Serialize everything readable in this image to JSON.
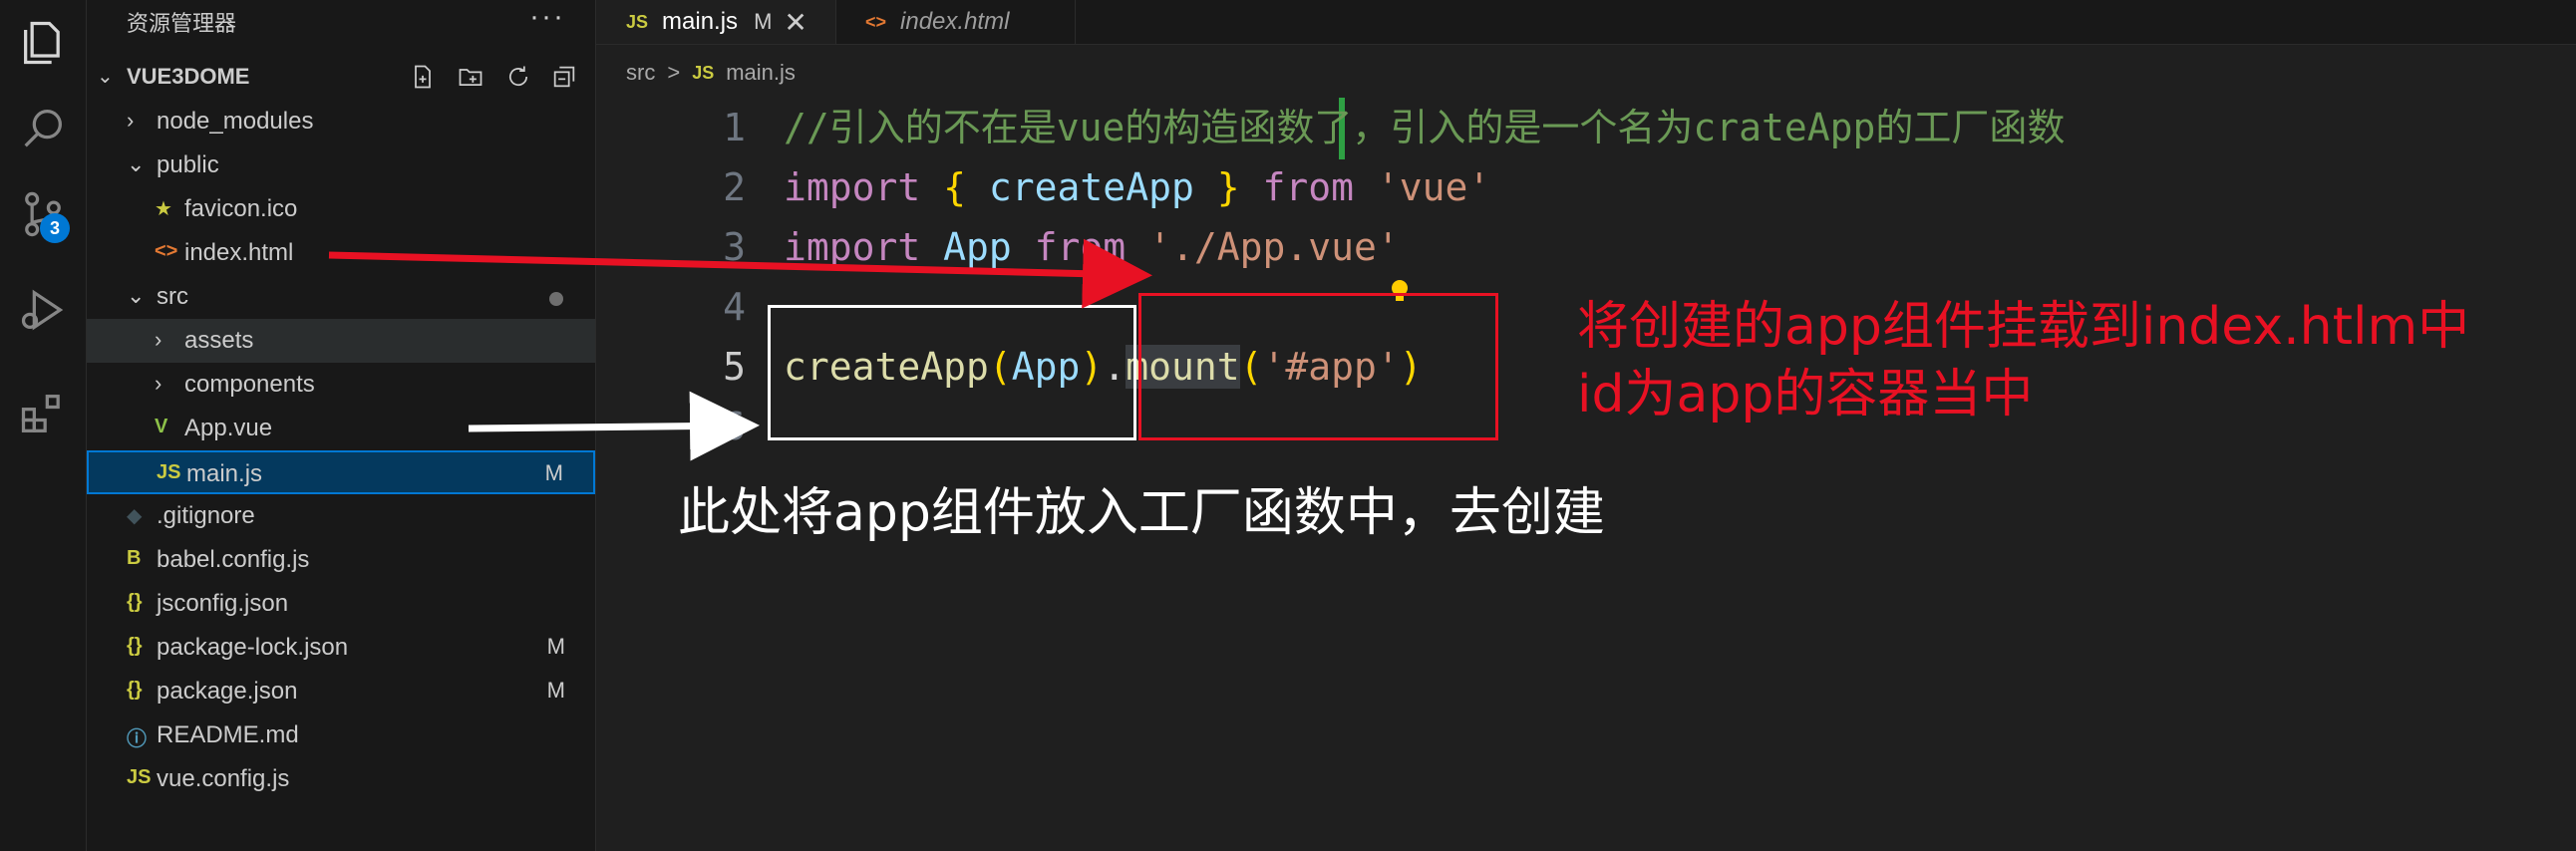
{
  "sidebar": {
    "title": "资源管理器",
    "more": "···",
    "project": "VUE3DOME",
    "project_actions": [
      "new-file-icon",
      "new-folder-icon",
      "refresh-icon",
      "collapse-icon"
    ],
    "items": [
      {
        "label": "node_modules",
        "type": "folder",
        "expanded": false,
        "depth": 1
      },
      {
        "label": "public",
        "type": "folder",
        "expanded": true,
        "depth": 1
      },
      {
        "label": "favicon.ico",
        "type": "file",
        "icon": "★",
        "icon_color": "#cbcb41",
        "depth": 2
      },
      {
        "label": "index.html",
        "type": "file",
        "icon": "<>",
        "icon_color": "#e37933",
        "depth": 2
      },
      {
        "label": "src",
        "type": "folder",
        "expanded": true,
        "depth": 1,
        "dot": true
      },
      {
        "label": "assets",
        "type": "folder",
        "expanded": false,
        "depth": 2,
        "hl": true
      },
      {
        "label": "components",
        "type": "folder",
        "expanded": false,
        "depth": 2
      },
      {
        "label": "App.vue",
        "type": "file",
        "icon": "V",
        "icon_color": "#8dc149",
        "depth": 2
      },
      {
        "label": "main.js",
        "type": "file",
        "icon": "JS",
        "icon_color": "#cbcb41",
        "depth": 2,
        "selected": true,
        "git": "M"
      },
      {
        "label": ".gitignore",
        "type": "file",
        "icon": "◆",
        "icon_color": "#41535b",
        "depth": 1
      },
      {
        "label": "babel.config.js",
        "type": "file",
        "icon": "B",
        "icon_color": "#cbcb41",
        "depth": 1
      },
      {
        "label": "jsconfig.json",
        "type": "file",
        "icon": "{}",
        "icon_color": "#cbcb41",
        "depth": 1
      },
      {
        "label": "package-lock.json",
        "type": "file",
        "icon": "{}",
        "icon_color": "#cbcb41",
        "depth": 1,
        "git": "M"
      },
      {
        "label": "package.json",
        "type": "file",
        "icon": "{}",
        "icon_color": "#cbcb41",
        "depth": 1,
        "git": "M"
      },
      {
        "label": "README.md",
        "type": "file",
        "icon": "ⓘ",
        "icon_color": "#519aba",
        "depth": 1
      },
      {
        "label": "vue.config.js",
        "type": "file",
        "icon": "JS",
        "icon_color": "#cbcb41",
        "depth": 1
      }
    ]
  },
  "activity": {
    "badge": "3"
  },
  "tabs": [
    {
      "label": "main.js",
      "icon": "JS",
      "icon_color": "#cbcb41",
      "modified": "M",
      "close": "✕",
      "active": true
    },
    {
      "label": "index.html",
      "icon": "<>",
      "icon_color": "#e37933",
      "active": false
    }
  ],
  "breadcrumb": {
    "folder": "src",
    "sep": ">",
    "file_icon": "JS",
    "file": "main.js"
  },
  "code": {
    "lines": [
      {
        "n": "1",
        "segments": [
          {
            "t": "//引入的不在是vue的构造函数了，引入的是一个名为crateApp的工厂函数",
            "c": "c-comment"
          }
        ]
      },
      {
        "n": "2",
        "segments": [
          {
            "t": "import ",
            "c": "c-kw"
          },
          {
            "t": "{ ",
            "c": "c-brace"
          },
          {
            "t": "createApp ",
            "c": "c-var"
          },
          {
            "t": "} ",
            "c": "c-brace"
          },
          {
            "t": "from ",
            "c": "c-kw"
          },
          {
            "t": "'vue'",
            "c": "c-str"
          }
        ]
      },
      {
        "n": "3",
        "segments": [
          {
            "t": "import ",
            "c": "c-kw"
          },
          {
            "t": "App ",
            "c": "c-var"
          },
          {
            "t": "from ",
            "c": "c-kw"
          },
          {
            "t": "'./App.vue'",
            "c": "c-str"
          }
        ]
      },
      {
        "n": "4",
        "segments": []
      },
      {
        "n": "5",
        "current": true,
        "segments": [
          {
            "t": "createApp",
            "c": "c-fn"
          },
          {
            "t": "(",
            "c": "c-brace"
          },
          {
            "t": "App",
            "c": "c-var"
          },
          {
            "t": ")",
            "c": "c-brace"
          },
          {
            "t": ".",
            "c": "c-plain"
          },
          {
            "t": "mount",
            "c": "c-fn c-hl"
          },
          {
            "t": "(",
            "c": "c-brace"
          },
          {
            "t": "'#app'",
            "c": "c-str"
          },
          {
            "t": ")",
            "c": "c-brace"
          }
        ]
      },
      {
        "n": "6",
        "segments": []
      }
    ]
  },
  "annotations": {
    "red_text": "将创建的app组件挂载到index.htlm中\nid为app的容器当中",
    "white_text": "此处将app组件放入工厂函数中，去创建",
    "red_color": "#e81123",
    "white_color": "#ffffff"
  }
}
